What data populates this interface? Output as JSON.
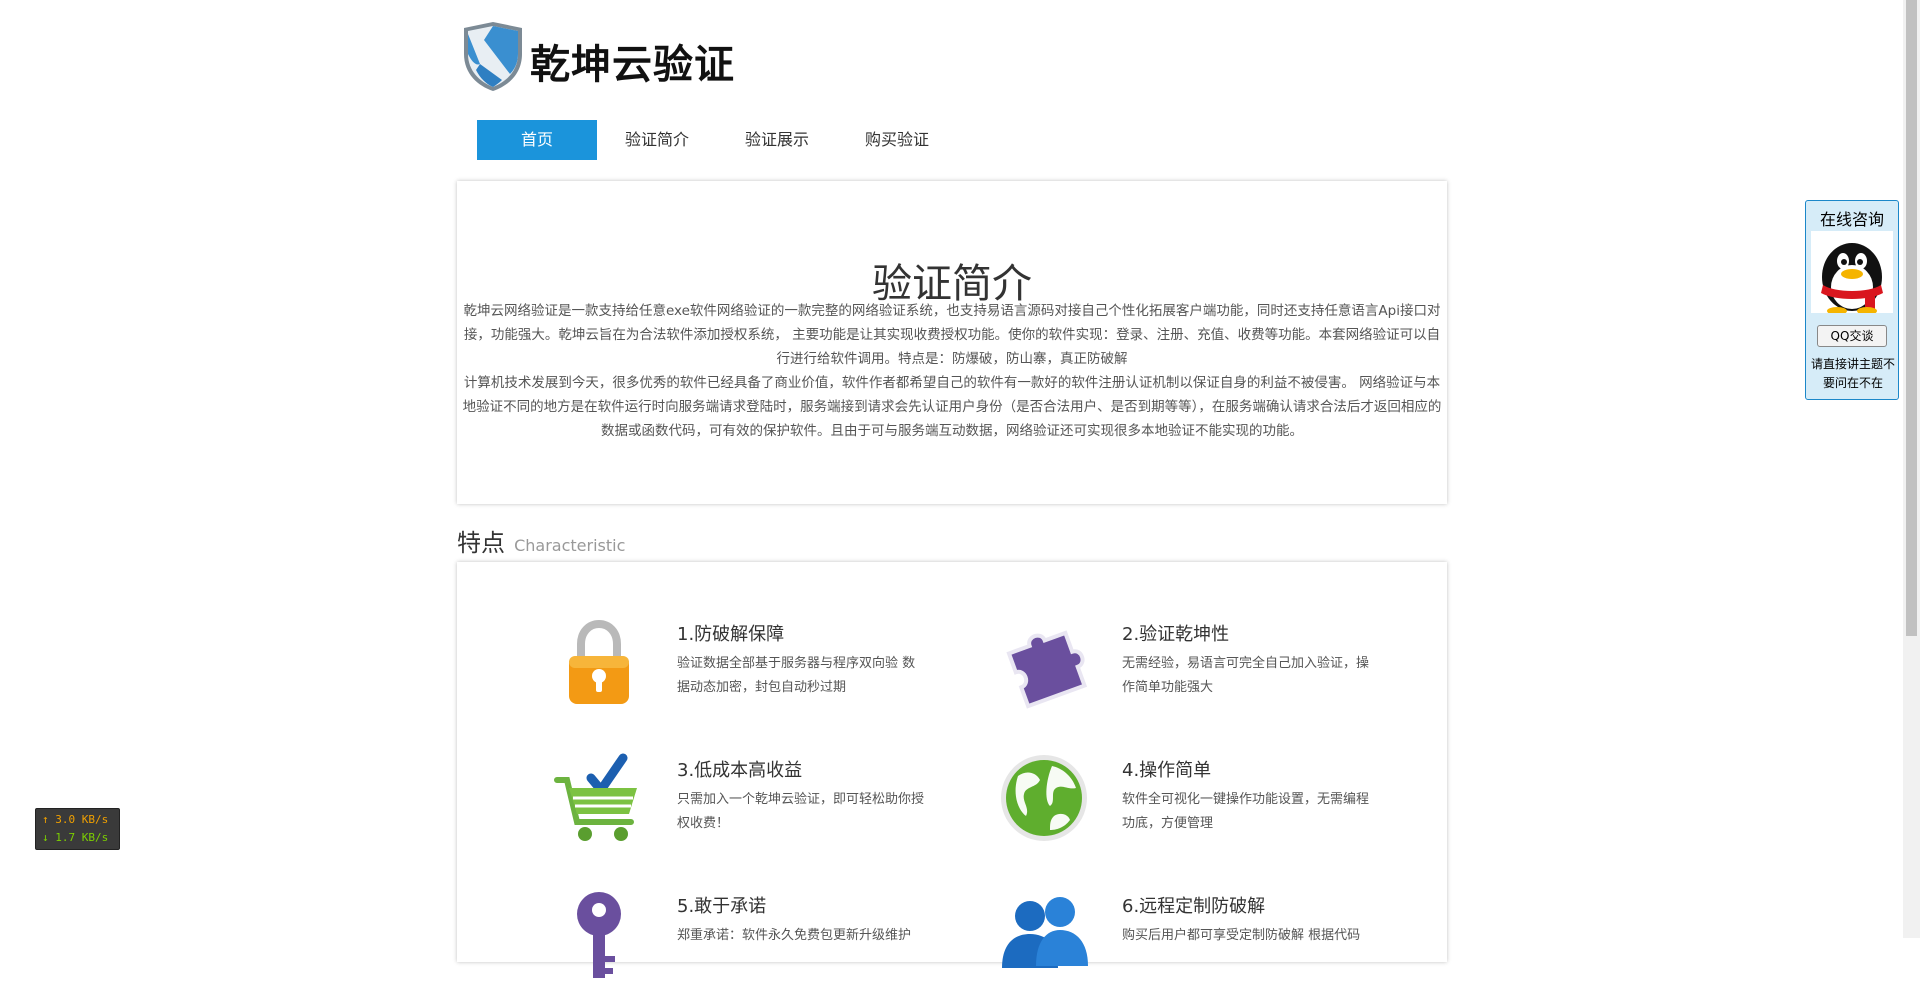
{
  "header": {
    "logo_text": "乾坤云验证"
  },
  "nav": {
    "items": [
      {
        "label": "首页",
        "active": true
      },
      {
        "label": "验证简介",
        "active": false
      },
      {
        "label": "验证展示",
        "active": false
      },
      {
        "label": "购买验证",
        "active": false
      }
    ]
  },
  "intro": {
    "title": "验证简介",
    "p1": "乾坤云网络验证是一款支持给任意exe软件网络验证的一款完整的网络验证系统，也支持易语言源码对接自己个性化拓展客户端功能，同时还支持任意语言Api接口对接，功能强大。乾坤云旨在为合法软件添加授权系统， 主要功能是让其实现收费授权功能。使你的软件实现：登录、注册、充值、收费等功能。本套网络验证可以自行进行给软件调用。特点是：防爆破，防山寨，真正防破解",
    "p2": "计算机技术发展到今天，很多优秀的软件已经具备了商业价值，软件作者都希望自己的软件有一款好的软件注册认证机制以保证自身的利益不被侵害。 网络验证与本地验证不同的地方是在软件运行时向服务端请求登陆时，服务端接到请求会先认证用户身份（是否合法用户、是否到期等等），在服务端确认请求合法后才返回相应的数据或函数代码，可有效的保护软件。且由于可与服务端互动数据，网络验证还可实现很多本地验证不能实现的功能。"
  },
  "features": {
    "heading_cn": "特点",
    "heading_en": "Characteristic",
    "items": [
      {
        "title": "1.防破解保障",
        "desc": "验证数据全部基于服务器与程序双向验 数据动态加密，封包自动秒过期",
        "icon": "lock-icon"
      },
      {
        "title": "2.验证乾坤性",
        "desc": "无需经验，易语言可完全自己加入验证，操作简单功能强大",
        "icon": "puzzle-icon"
      },
      {
        "title": "3.低成本高收益",
        "desc": "只需加入一个乾坤云验证，即可轻松助你授权收费！",
        "icon": "cart-icon"
      },
      {
        "title": "4.操作简单",
        "desc": "软件全可视化一键操作功能设置，无需编程功底，方便管理",
        "icon": "globe-icon"
      },
      {
        "title": "5.敢于承诺",
        "desc": "郑重承诺：软件永久免费包更新升级维护",
        "icon": "key-icon"
      },
      {
        "title": "6.远程定制防破解",
        "desc": "购买后用户都可享受定制防破解 根据代码",
        "icon": "users-icon"
      }
    ]
  },
  "qq_widget": {
    "title": "在线咨询",
    "button": "QQ交谈",
    "note": "请直接讲主题不要问在不在"
  },
  "net_speed": {
    "up": "↑ 3.0 KB/s",
    "down": "↓ 1.7 KB/s"
  }
}
